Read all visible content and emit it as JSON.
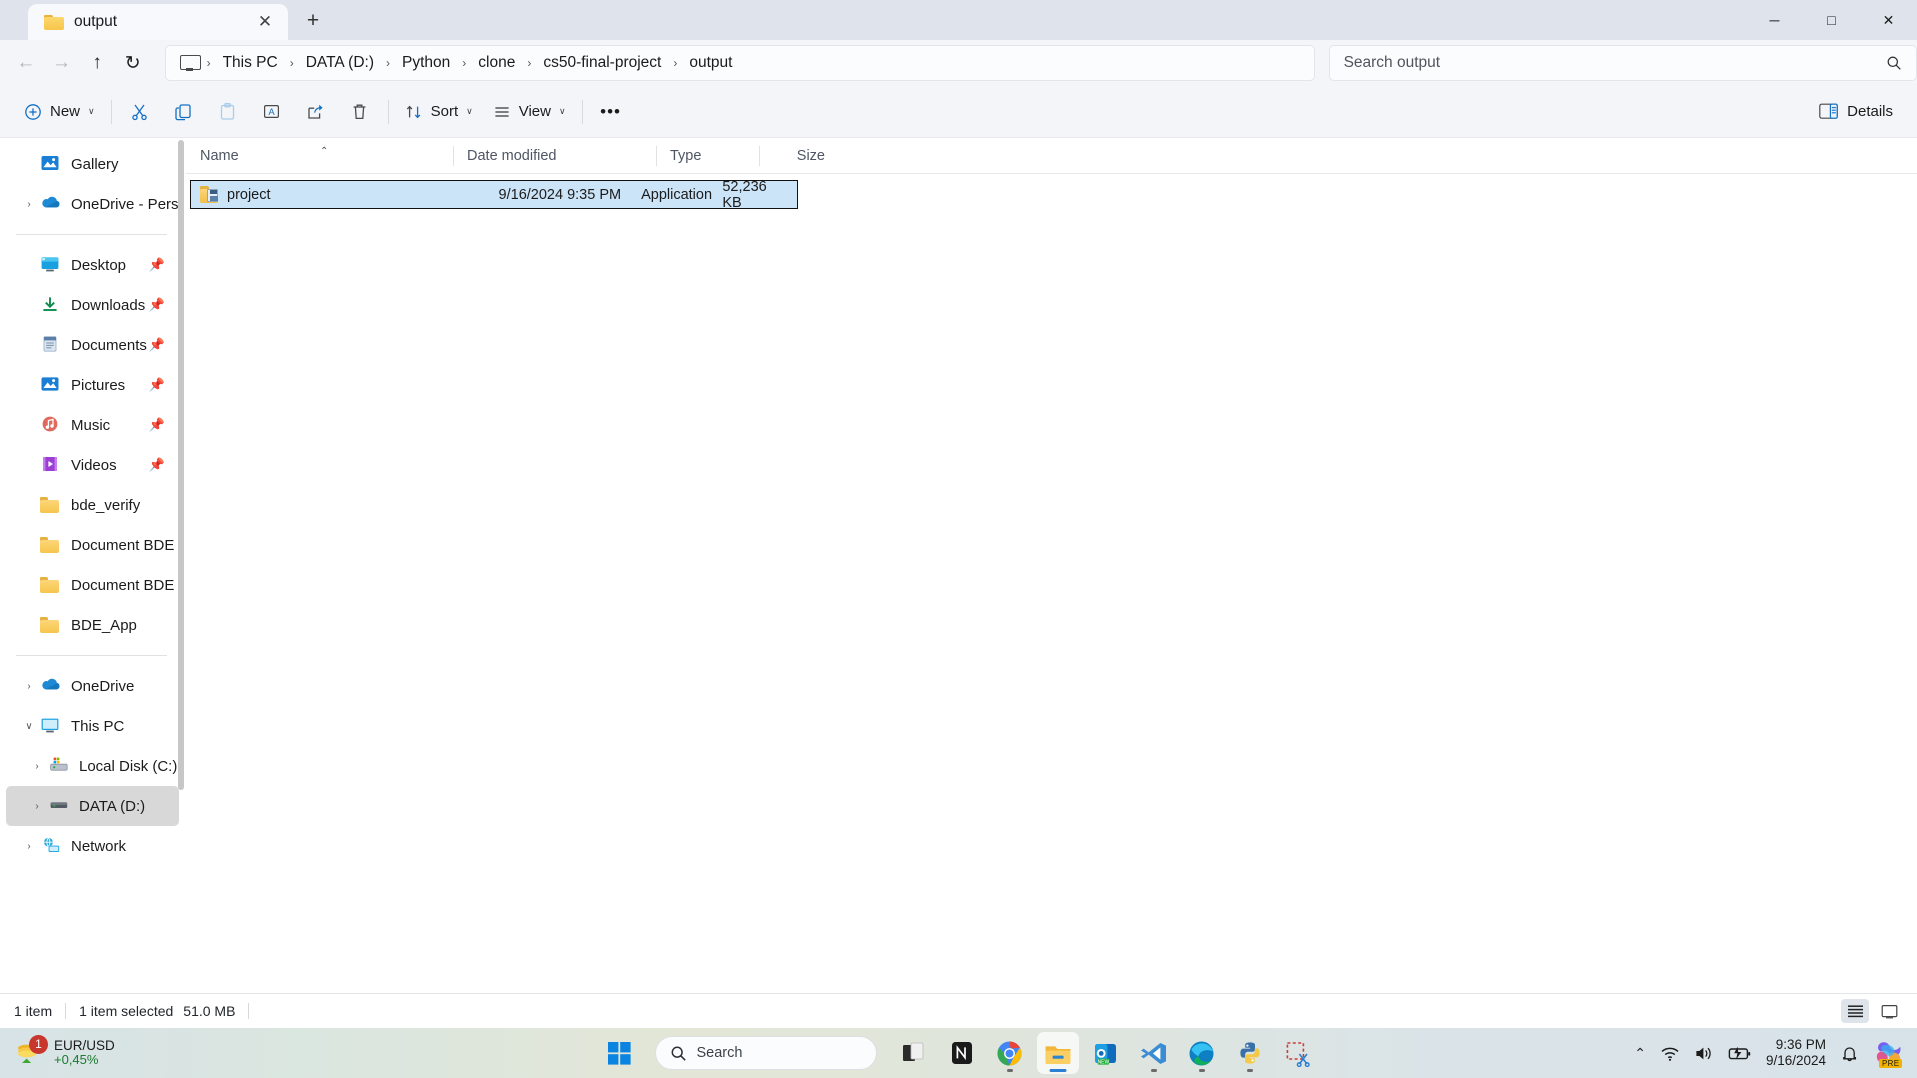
{
  "window": {
    "tab": {
      "title": "output",
      "icon": "folder-icon",
      "close_label": "✕"
    },
    "new_tab_label": "+",
    "controls": {
      "minimize": "─",
      "maximize": "□",
      "close": "✕"
    }
  },
  "nav": {
    "back": "←",
    "forward": "→",
    "up": "↑",
    "refresh": "↻"
  },
  "breadcrumb": {
    "root_icon": "this-pc-icon",
    "separator": "›",
    "items": [
      "This PC",
      "DATA (D:)",
      "Python",
      "clone",
      "cs50-final-project",
      "output"
    ]
  },
  "search": {
    "placeholder": "Search output",
    "icon": "search-icon"
  },
  "toolbar": {
    "new_label": "New",
    "cut_label": "Cut",
    "copy_label": "Copy",
    "paste_label": "Paste",
    "rename_label": "Rename",
    "share_label": "Share",
    "delete_label": "Delete",
    "sort_label": "Sort",
    "view_label": "View",
    "more_label": "•••",
    "details_label": "Details",
    "caret": "∨"
  },
  "sidebar": {
    "items": [
      {
        "label": "Gallery",
        "icon": "gallery-icon",
        "chevron": "",
        "pinned": false,
        "indent": 0,
        "selected": false
      },
      {
        "label": "OneDrive - Perso",
        "icon": "onedrive-icon",
        "chevron": "›",
        "pinned": false,
        "indent": 0,
        "selected": false
      },
      {
        "divider": true
      },
      {
        "label": "Desktop",
        "icon": "desktop-icon",
        "chevron": "",
        "pinned": true,
        "indent": 0,
        "selected": false
      },
      {
        "label": "Downloads",
        "icon": "downloads-icon",
        "chevron": "",
        "pinned": true,
        "indent": 0,
        "selected": false
      },
      {
        "label": "Documents",
        "icon": "documents-icon",
        "chevron": "",
        "pinned": true,
        "indent": 0,
        "selected": false
      },
      {
        "label": "Pictures",
        "icon": "pictures-icon",
        "chevron": "",
        "pinned": true,
        "indent": 0,
        "selected": false
      },
      {
        "label": "Music",
        "icon": "music-icon",
        "chevron": "",
        "pinned": true,
        "indent": 0,
        "selected": false
      },
      {
        "label": "Videos",
        "icon": "videos-icon",
        "chevron": "",
        "pinned": true,
        "indent": 0,
        "selected": false
      },
      {
        "label": "bde_verify",
        "icon": "folder-icon",
        "chevron": "",
        "pinned": false,
        "indent": 0,
        "selected": false
      },
      {
        "label": "Document BDE",
        "icon": "folder-icon",
        "chevron": "",
        "pinned": false,
        "indent": 0,
        "selected": false
      },
      {
        "label": "Document BDE",
        "icon": "folder-icon",
        "chevron": "",
        "pinned": false,
        "indent": 0,
        "selected": false
      },
      {
        "label": "BDE_App",
        "icon": "folder-icon",
        "chevron": "",
        "pinned": false,
        "indent": 0,
        "selected": false
      },
      {
        "divider": true
      },
      {
        "label": "OneDrive",
        "icon": "onedrive-icon",
        "chevron": "›",
        "pinned": false,
        "indent": 0,
        "selected": false
      },
      {
        "label": "This PC",
        "icon": "this-pc-icon",
        "chevron": "∨",
        "pinned": false,
        "indent": 0,
        "selected": false
      },
      {
        "label": "Local Disk (C:)",
        "icon": "local-disk-icon",
        "chevron": "›",
        "pinned": false,
        "indent": 1,
        "selected": false
      },
      {
        "label": "DATA (D:)",
        "icon": "drive-icon",
        "chevron": "›",
        "pinned": false,
        "indent": 1,
        "selected": true
      },
      {
        "label": "Network",
        "icon": "network-icon",
        "chevron": "›",
        "pinned": false,
        "indent": 0,
        "selected": false
      }
    ]
  },
  "filelist": {
    "columns": [
      "Name",
      "Date modified",
      "Type",
      "Size"
    ],
    "sort_column": "Name",
    "sort_indicator": "⌃",
    "rows": [
      {
        "name": "project",
        "icon": "application-file-icon",
        "date_modified": "9/16/2024 9:35 PM",
        "type": "Application",
        "size": "52,236 KB",
        "selected": true
      }
    ]
  },
  "statusbar": {
    "item_count": "1 item",
    "selection": "1 item selected",
    "selection_size": "51.0 MB",
    "view_details_icon": "details-view-icon",
    "view_thumbnails_icon": "large-icons-view-icon"
  },
  "taskbar": {
    "widget": {
      "title": "EUR/USD",
      "change": "+0,45%",
      "badge": "1",
      "icon": "coins-icon"
    },
    "start_label": "Start",
    "search": {
      "placeholder": "Search",
      "icon": "search-icon"
    },
    "apps": [
      {
        "name": "task-view",
        "running": false,
        "active": false
      },
      {
        "name": "notion",
        "running": false,
        "active": false
      },
      {
        "name": "google-chrome",
        "running": true,
        "active": false
      },
      {
        "name": "file-explorer",
        "running": true,
        "active": true
      },
      {
        "name": "outlook-new",
        "running": false,
        "active": false
      },
      {
        "name": "visual-studio",
        "running": true,
        "active": false
      },
      {
        "name": "microsoft-edge",
        "running": true,
        "active": false
      },
      {
        "name": "python",
        "running": true,
        "active": false
      },
      {
        "name": "snipping-tool",
        "running": false,
        "active": false
      }
    ],
    "tray": {
      "chevron": "⌃",
      "wifi": "wifi-icon",
      "volume": "volume-icon",
      "battery": "battery-charging-icon",
      "time": "9:36 PM",
      "date": "9/16/2024",
      "notifications": "bell-icon",
      "copilot": "copilot-icon",
      "copilot_badge": "PRE"
    }
  },
  "colors": {
    "selection": "#cce4f7",
    "accent": "#1570c4",
    "titlebar": "#dfe4ec",
    "chrome": "#f3f5f9",
    "positive": "#1a7a2e"
  }
}
